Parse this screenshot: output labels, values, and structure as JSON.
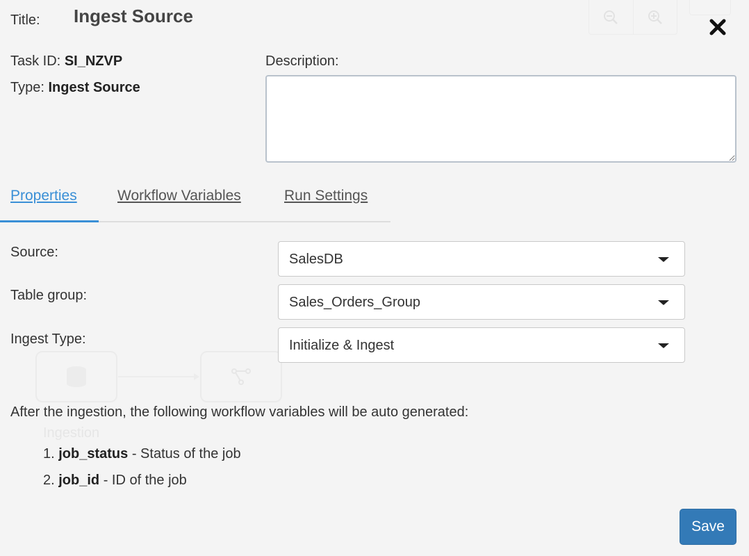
{
  "header": {
    "title_label": "Title:",
    "title_value": "Ingest Source"
  },
  "meta": {
    "task_id_label": "Task ID:",
    "task_id_value": "SI_NZVP",
    "type_label": "Type:",
    "type_value": "Ingest Source"
  },
  "description": {
    "label": "Description:",
    "value": ""
  },
  "tabs": [
    {
      "label": "Properties",
      "active": true
    },
    {
      "label": "Workflow Variables",
      "active": false
    },
    {
      "label": "Run Settings",
      "active": false
    }
  ],
  "fields": {
    "source": {
      "label": "Source:",
      "value": "SalesDB"
    },
    "table_group": {
      "label": "Table group:",
      "value": "Sales_Orders_Group"
    },
    "ingest_type": {
      "label": "Ingest Type:",
      "value": "Initialize & Ingest"
    }
  },
  "note": "After the ingestion, the following workflow variables will be auto generated:",
  "variables": [
    {
      "num": "1.",
      "name": "job_status",
      "desc": "- Status of the job"
    },
    {
      "num": "2.",
      "name": "job_id",
      "desc": "- ID of the job"
    }
  ],
  "background": {
    "node_label": "Ingestion",
    "zoom_out_icon": "zoom-out-icon",
    "zoom_in_icon": "zoom-in-icon",
    "database_icon": "database-icon",
    "workflow_icon": "workflow-icon"
  },
  "actions": {
    "save_label": "Save"
  },
  "colors": {
    "accent": "#3a8fd6",
    "save_button": "#337ab7",
    "background": "#f4f4f4"
  }
}
